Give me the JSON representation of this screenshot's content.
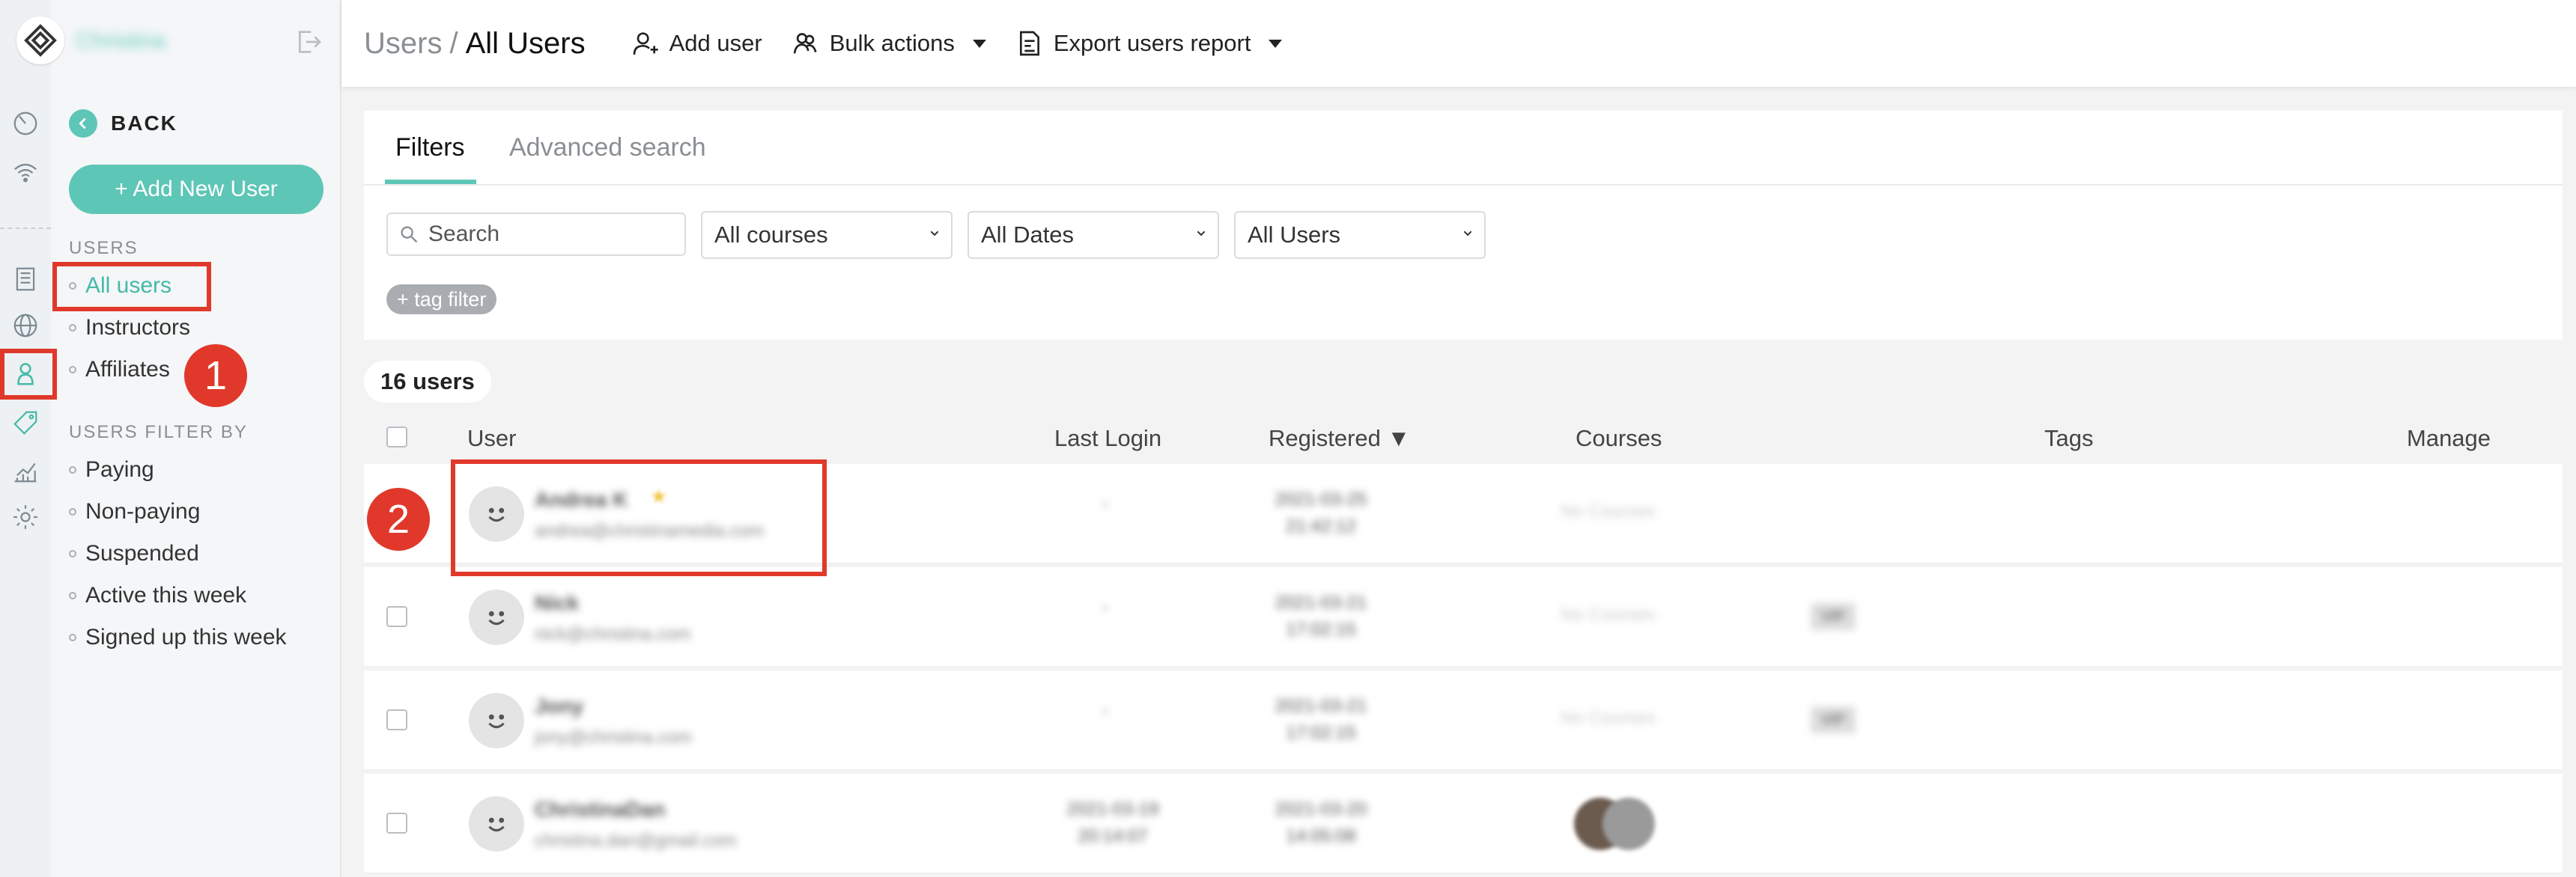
{
  "brand": {
    "name": "Christina"
  },
  "rail_icons": [
    "dashboard-icon",
    "broadcast-icon",
    "pages-icon",
    "globe-icon",
    "users-icon",
    "tag-icon",
    "analytics-icon",
    "settings-icon"
  ],
  "sidebar": {
    "back_label": "BACK",
    "add_new_user_label": "+ Add New User",
    "users_heading": "USERS",
    "users_items": [
      {
        "label": "All users",
        "active": true
      },
      {
        "label": "Instructors",
        "active": false
      },
      {
        "label": "Affiliates",
        "active": false
      }
    ],
    "filter_heading": "USERS FILTER BY",
    "filter_items": [
      {
        "label": "Paying"
      },
      {
        "label": "Non-paying"
      },
      {
        "label": "Suspended"
      },
      {
        "label": "Active this week"
      },
      {
        "label": "Signed up this week"
      }
    ]
  },
  "annotations": {
    "badge1": "1",
    "badge2": "2",
    "color": "#e0392b"
  },
  "header": {
    "breadcrumb_parent": "Users",
    "breadcrumb_sep": "/",
    "breadcrumb_current": "All Users",
    "add_user_label": "Add user",
    "bulk_actions_label": "Bulk actions",
    "export_label": "Export users report"
  },
  "filters": {
    "tabs": [
      "Filters",
      "Advanced search"
    ],
    "active_tab": "Filters",
    "search_placeholder": "Search",
    "selects": [
      "All courses",
      "All Dates",
      "All Users"
    ],
    "tag_filter_label": "+ tag filter"
  },
  "count_label": "16 users",
  "table": {
    "columns": [
      "User",
      "Last Login",
      "Registered ▼",
      "Courses",
      "Tags",
      "Manage"
    ],
    "rows": [
      {
        "name": "Andrea K",
        "email": "andrea@christinamedia.com",
        "last_login": "-",
        "registered": [
          "2021-03-25",
          "21:42:12"
        ],
        "courses": "No Courses",
        "tag": "",
        "star": true
      },
      {
        "name": "Nick",
        "email": "nick@christina.com",
        "last_login": "-",
        "registered": [
          "2021-03-21",
          "17:02:15"
        ],
        "courses": "No Courses",
        "tag": "VIP",
        "star": false
      },
      {
        "name": "Jony",
        "email": "jony@christina.com",
        "last_login": "-",
        "registered": [
          "2021-03-21",
          "17:02:15"
        ],
        "courses": "No Courses",
        "tag": "VIP",
        "star": false
      },
      {
        "name": "ChristinaDan",
        "email": "christina.dan@gmail.com",
        "last_login": [
          "2021-03-19",
          "20:14:07"
        ],
        "registered": [
          "2021-03-20",
          "14:05:08"
        ],
        "courses": "",
        "tag": "",
        "star": false
      }
    ]
  },
  "colors": {
    "accent": "#5ec6b6",
    "annotation": "#e0392b"
  }
}
